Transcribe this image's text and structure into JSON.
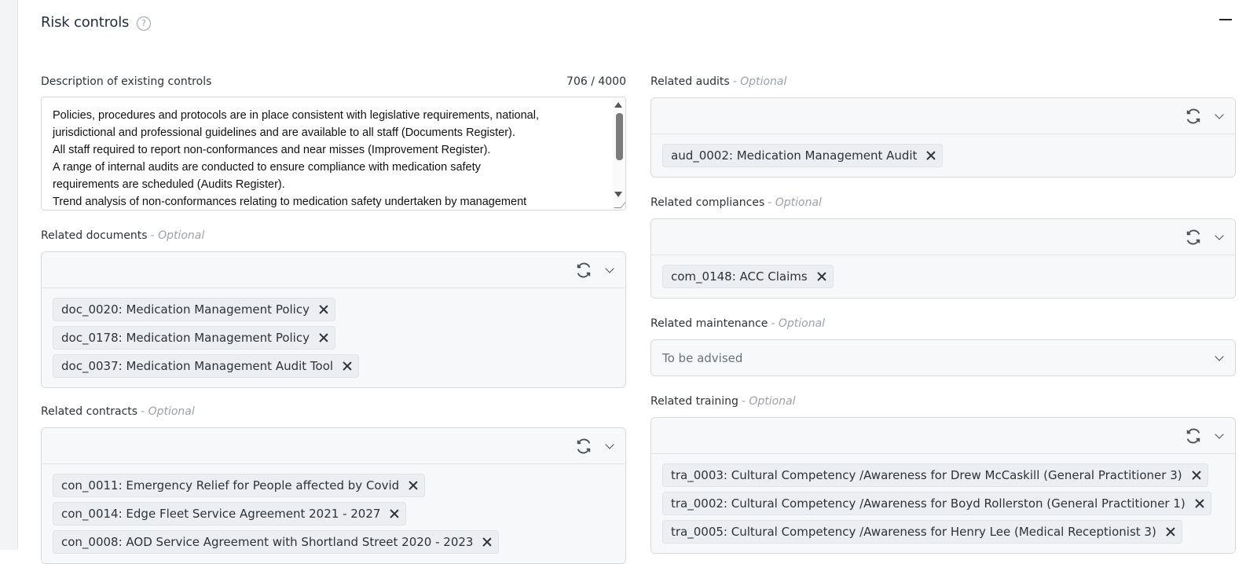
{
  "section": {
    "title": "Risk controls"
  },
  "description": {
    "label": "Description of existing controls",
    "counter": "706 / 4000",
    "value": "Policies, procedures and protocols are in place consistent with legislative requirements, national,\njurisdictional and professional guidelines and are available to all staff (Documents Register).\nAll staff required to report non-conformances and near misses (Improvement Register).\nA range of internal audits are conducted to ensure compliance with medication safety\nrequirements are scheduled (Audits Register).\nTrend analysis of non-conformances relating to medication safety undertaken by management"
  },
  "optional_suffix": "- Optional",
  "documents": {
    "label": "Related documents",
    "items": [
      "doc_0020: Medication Management Policy",
      "doc_0178: Medication Management Policy",
      "doc_0037: Medication Management Audit Tool"
    ]
  },
  "contracts": {
    "label": "Related contracts",
    "items": [
      "con_0011: Emergency Relief for People affected by Covid",
      "con_0014: Edge Fleet Service Agreement 2021 - 2027",
      "con_0008: AOD Service Agreement with Shortland Street 2020 - 2023"
    ]
  },
  "audits": {
    "label": "Related audits",
    "items": [
      "aud_0002: Medication Management Audit"
    ]
  },
  "compliances": {
    "label": "Related compliances",
    "items": [
      "com_0148: ACC Claims"
    ]
  },
  "maintenance": {
    "label": "Related maintenance",
    "value": "To be advised"
  },
  "training": {
    "label": "Related training",
    "items": [
      "tra_0003: Cultural Competency /Awareness for Drew McCaskill (General Practitioner 3)",
      "tra_0002: Cultural Competency /Awareness for Boyd Rollerston (General Practitioner 1)",
      "tra_0005: Cultural Competency /Awareness for Henry Lee (Medical Receptionist 3)"
    ]
  }
}
